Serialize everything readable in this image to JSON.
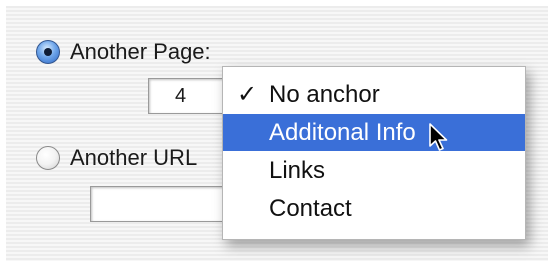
{
  "options": {
    "another_page_label": "Another Page:",
    "another_url_label": "Another URL"
  },
  "page_number_field": {
    "value": "4"
  },
  "anchor_menu": {
    "items": [
      {
        "label": "No anchor",
        "checked": true,
        "check_glyph": "✓"
      },
      {
        "label": "Additonal Info",
        "highlighted": true
      },
      {
        "label": "Links"
      },
      {
        "label": "Contact"
      }
    ]
  },
  "icons": {
    "checkmark": "checkmark-icon",
    "cursor": "mouse-pointer-icon"
  },
  "colors": {
    "highlight": "#3a6fd8",
    "radio_selected": "#2b66c5"
  }
}
